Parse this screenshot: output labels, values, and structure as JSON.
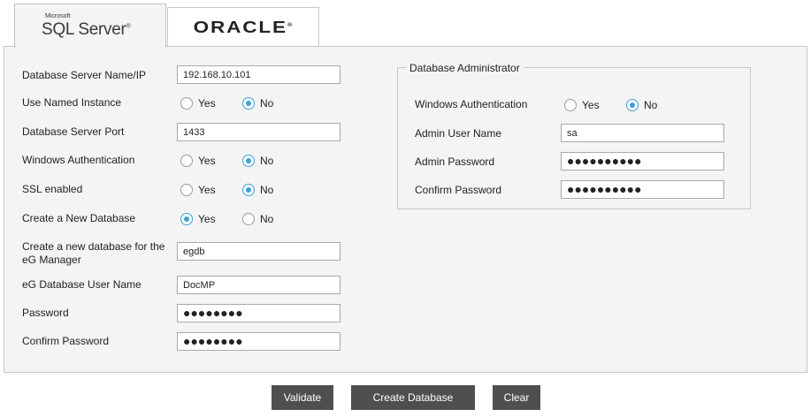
{
  "tabs": {
    "sql_server": {
      "brand": "Microsoft",
      "name": "SQL Server",
      "mark": "®"
    },
    "oracle": {
      "name": "ORACLE",
      "mark": "®"
    }
  },
  "left": {
    "server_name": {
      "label": "Database Server Name/IP",
      "value": "192.168.10.101"
    },
    "named_instance": {
      "label": "Use Named Instance",
      "yes": "Yes",
      "no": "No",
      "selected": "No"
    },
    "port": {
      "label": "Database Server Port",
      "value": "1433"
    },
    "windows_auth": {
      "label": "Windows Authentication",
      "yes": "Yes",
      "no": "No",
      "selected": "No"
    },
    "ssl": {
      "label": "SSL enabled",
      "yes": "Yes",
      "no": "No",
      "selected": "No"
    },
    "create_db": {
      "label": "Create a New Database",
      "yes": "Yes",
      "no": "No",
      "selected": "Yes"
    },
    "new_db_name": {
      "label_line1": "Create a new database for the",
      "label_line2": "eG Manager",
      "value": "egdb"
    },
    "db_user": {
      "label": "eG Database User Name",
      "value": "DocMP"
    },
    "password": {
      "label": "Password",
      "value": "●●●●●●●●"
    },
    "confirm_password": {
      "label": "Confirm Password",
      "value": "●●●●●●●●"
    }
  },
  "admin": {
    "legend": "Database Administrator",
    "windows_auth": {
      "label": "Windows Authentication",
      "yes": "Yes",
      "no": "No",
      "selected": "No"
    },
    "user": {
      "label": "Admin User Name",
      "value": "sa"
    },
    "password": {
      "label": "Admin Password",
      "value": "●●●●●●●●●●"
    },
    "confirm": {
      "label": "Confirm Password",
      "value": "●●●●●●●●●●"
    }
  },
  "buttons": {
    "validate": "Validate",
    "create": "Create Database",
    "clear": "Clear"
  },
  "colors": {
    "panel": "#f4f4f4",
    "button": "#4f4f4f",
    "radio_accent": "#3aa0d8",
    "border": "#c8c8c8"
  }
}
